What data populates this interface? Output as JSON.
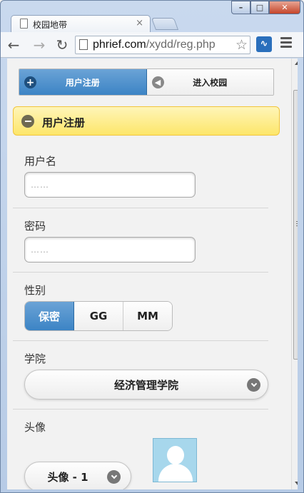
{
  "browser": {
    "tab_title": "校园地带",
    "tab_close": "×",
    "url_host": "phrief.com",
    "url_path": "/xydd/reg.php",
    "back_icon": "←",
    "forward_icon": "→",
    "reload_icon": "↻",
    "star_icon": "☆",
    "window_min": "–",
    "window_max": "□",
    "window_close": "✕"
  },
  "nav": {
    "register_label": "用户注册",
    "enter_label": "进入校园",
    "register_icon": "+",
    "enter_icon": "◀"
  },
  "section": {
    "title": "用户注册"
  },
  "form": {
    "username_label": "用户名",
    "username_placeholder": "……",
    "password_label": "密码",
    "password_placeholder": "……",
    "gender_label": "性别",
    "gender_options": [
      "保密",
      "GG",
      "MM"
    ],
    "gender_selected": "保密",
    "college_label": "学院",
    "college_value": "经济管理学院",
    "avatar_label": "头像",
    "avatar_value": "头像 - 1"
  },
  "colors": {
    "accent_blue": "#3c84c5",
    "header_yellow": "#fde66a"
  }
}
